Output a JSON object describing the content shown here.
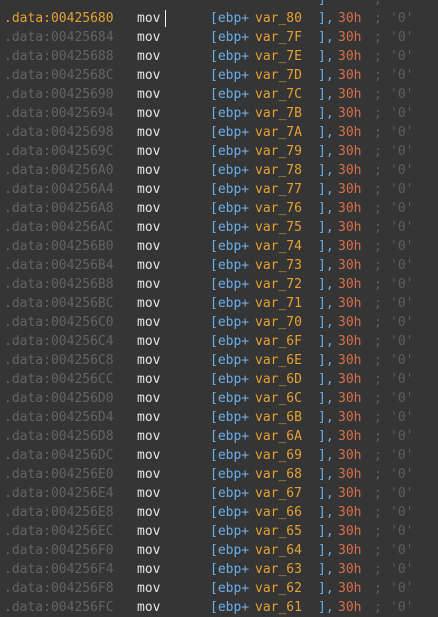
{
  "colors": {
    "background": "#353535",
    "address": "#636363",
    "address_current": "#e4a132",
    "mnemonic": "#e4e4e4",
    "operand_bracket": "#6aaee8",
    "variable": "#e4a132",
    "immediate": "#d86f4c",
    "comment": "#5d5d5d"
  },
  "top_partial": {
    "operand_close": "]",
    "semicolon": ";"
  },
  "current_index": 0,
  "rows": [
    {
      "address": ".data:00425680",
      "mnemonic": "mov",
      "op_base": "[ebp+",
      "op_var": "var_80",
      "op_close": "],",
      "immediate": "30h",
      "semicolon": ";",
      "char": "'0'"
    },
    {
      "address": ".data:00425684",
      "mnemonic": "mov",
      "op_base": "[ebp+",
      "op_var": "var_7F",
      "op_close": "],",
      "immediate": "30h",
      "semicolon": ";",
      "char": "'0'"
    },
    {
      "address": ".data:00425688",
      "mnemonic": "mov",
      "op_base": "[ebp+",
      "op_var": "var_7E",
      "op_close": "],",
      "immediate": "30h",
      "semicolon": ";",
      "char": "'0'"
    },
    {
      "address": ".data:0042568C",
      "mnemonic": "mov",
      "op_base": "[ebp+",
      "op_var": "var_7D",
      "op_close": "],",
      "immediate": "30h",
      "semicolon": ";",
      "char": "'0'"
    },
    {
      "address": ".data:00425690",
      "mnemonic": "mov",
      "op_base": "[ebp+",
      "op_var": "var_7C",
      "op_close": "],",
      "immediate": "30h",
      "semicolon": ";",
      "char": "'0'"
    },
    {
      "address": ".data:00425694",
      "mnemonic": "mov",
      "op_base": "[ebp+",
      "op_var": "var_7B",
      "op_close": "],",
      "immediate": "30h",
      "semicolon": ";",
      "char": "'0'"
    },
    {
      "address": ".data:00425698",
      "mnemonic": "mov",
      "op_base": "[ebp+",
      "op_var": "var_7A",
      "op_close": "],",
      "immediate": "30h",
      "semicolon": ";",
      "char": "'0'"
    },
    {
      "address": ".data:0042569C",
      "mnemonic": "mov",
      "op_base": "[ebp+",
      "op_var": "var_79",
      "op_close": "],",
      "immediate": "30h",
      "semicolon": ";",
      "char": "'0'"
    },
    {
      "address": ".data:004256A0",
      "mnemonic": "mov",
      "op_base": "[ebp+",
      "op_var": "var_78",
      "op_close": "],",
      "immediate": "30h",
      "semicolon": ";",
      "char": "'0'"
    },
    {
      "address": ".data:004256A4",
      "mnemonic": "mov",
      "op_base": "[ebp+",
      "op_var": "var_77",
      "op_close": "],",
      "immediate": "30h",
      "semicolon": ";",
      "char": "'0'"
    },
    {
      "address": ".data:004256A8",
      "mnemonic": "mov",
      "op_base": "[ebp+",
      "op_var": "var_76",
      "op_close": "],",
      "immediate": "30h",
      "semicolon": ";",
      "char": "'0'"
    },
    {
      "address": ".data:004256AC",
      "mnemonic": "mov",
      "op_base": "[ebp+",
      "op_var": "var_75",
      "op_close": "],",
      "immediate": "30h",
      "semicolon": ";",
      "char": "'0'"
    },
    {
      "address": ".data:004256B0",
      "mnemonic": "mov",
      "op_base": "[ebp+",
      "op_var": "var_74",
      "op_close": "],",
      "immediate": "30h",
      "semicolon": ";",
      "char": "'0'"
    },
    {
      "address": ".data:004256B4",
      "mnemonic": "mov",
      "op_base": "[ebp+",
      "op_var": "var_73",
      "op_close": "],",
      "immediate": "30h",
      "semicolon": ";",
      "char": "'0'"
    },
    {
      "address": ".data:004256B8",
      "mnemonic": "mov",
      "op_base": "[ebp+",
      "op_var": "var_72",
      "op_close": "],",
      "immediate": "30h",
      "semicolon": ";",
      "char": "'0'"
    },
    {
      "address": ".data:004256BC",
      "mnemonic": "mov",
      "op_base": "[ebp+",
      "op_var": "var_71",
      "op_close": "],",
      "immediate": "30h",
      "semicolon": ";",
      "char": "'0'"
    },
    {
      "address": ".data:004256C0",
      "mnemonic": "mov",
      "op_base": "[ebp+",
      "op_var": "var_70",
      "op_close": "],",
      "immediate": "30h",
      "semicolon": ";",
      "char": "'0'"
    },
    {
      "address": ".data:004256C4",
      "mnemonic": "mov",
      "op_base": "[ebp+",
      "op_var": "var_6F",
      "op_close": "],",
      "immediate": "30h",
      "semicolon": ";",
      "char": "'0'"
    },
    {
      "address": ".data:004256C8",
      "mnemonic": "mov",
      "op_base": "[ebp+",
      "op_var": "var_6E",
      "op_close": "],",
      "immediate": "30h",
      "semicolon": ";",
      "char": "'0'"
    },
    {
      "address": ".data:004256CC",
      "mnemonic": "mov",
      "op_base": "[ebp+",
      "op_var": "var_6D",
      "op_close": "],",
      "immediate": "30h",
      "semicolon": ";",
      "char": "'0'"
    },
    {
      "address": ".data:004256D0",
      "mnemonic": "mov",
      "op_base": "[ebp+",
      "op_var": "var_6C",
      "op_close": "],",
      "immediate": "30h",
      "semicolon": ";",
      "char": "'0'"
    },
    {
      "address": ".data:004256D4",
      "mnemonic": "mov",
      "op_base": "[ebp+",
      "op_var": "var_6B",
      "op_close": "],",
      "immediate": "30h",
      "semicolon": ";",
      "char": "'0'"
    },
    {
      "address": ".data:004256D8",
      "mnemonic": "mov",
      "op_base": "[ebp+",
      "op_var": "var_6A",
      "op_close": "],",
      "immediate": "30h",
      "semicolon": ";",
      "char": "'0'"
    },
    {
      "address": ".data:004256DC",
      "mnemonic": "mov",
      "op_base": "[ebp+",
      "op_var": "var_69",
      "op_close": "],",
      "immediate": "30h",
      "semicolon": ";",
      "char": "'0'"
    },
    {
      "address": ".data:004256E0",
      "mnemonic": "mov",
      "op_base": "[ebp+",
      "op_var": "var_68",
      "op_close": "],",
      "immediate": "30h",
      "semicolon": ";",
      "char": "'0'"
    },
    {
      "address": ".data:004256E4",
      "mnemonic": "mov",
      "op_base": "[ebp+",
      "op_var": "var_67",
      "op_close": "],",
      "immediate": "30h",
      "semicolon": ";",
      "char": "'0'"
    },
    {
      "address": ".data:004256E8",
      "mnemonic": "mov",
      "op_base": "[ebp+",
      "op_var": "var_66",
      "op_close": "],",
      "immediate": "30h",
      "semicolon": ";",
      "char": "'0'"
    },
    {
      "address": ".data:004256EC",
      "mnemonic": "mov",
      "op_base": "[ebp+",
      "op_var": "var_65",
      "op_close": "],",
      "immediate": "30h",
      "semicolon": ";",
      "char": "'0'"
    },
    {
      "address": ".data:004256F0",
      "mnemonic": "mov",
      "op_base": "[ebp+",
      "op_var": "var_64",
      "op_close": "],",
      "immediate": "30h",
      "semicolon": ";",
      "char": "'0'"
    },
    {
      "address": ".data:004256F4",
      "mnemonic": "mov",
      "op_base": "[ebp+",
      "op_var": "var_63",
      "op_close": "],",
      "immediate": "30h",
      "semicolon": ";",
      "char": "'0'"
    },
    {
      "address": ".data:004256F8",
      "mnemonic": "mov",
      "op_base": "[ebp+",
      "op_var": "var_62",
      "op_close": "],",
      "immediate": "30h",
      "semicolon": ";",
      "char": "'0'"
    },
    {
      "address": ".data:004256FC",
      "mnemonic": "mov",
      "op_base": "[ebp+",
      "op_var": "var_61",
      "op_close": "],",
      "immediate": "30h",
      "semicolon": ";",
      "char": "'0'"
    }
  ]
}
